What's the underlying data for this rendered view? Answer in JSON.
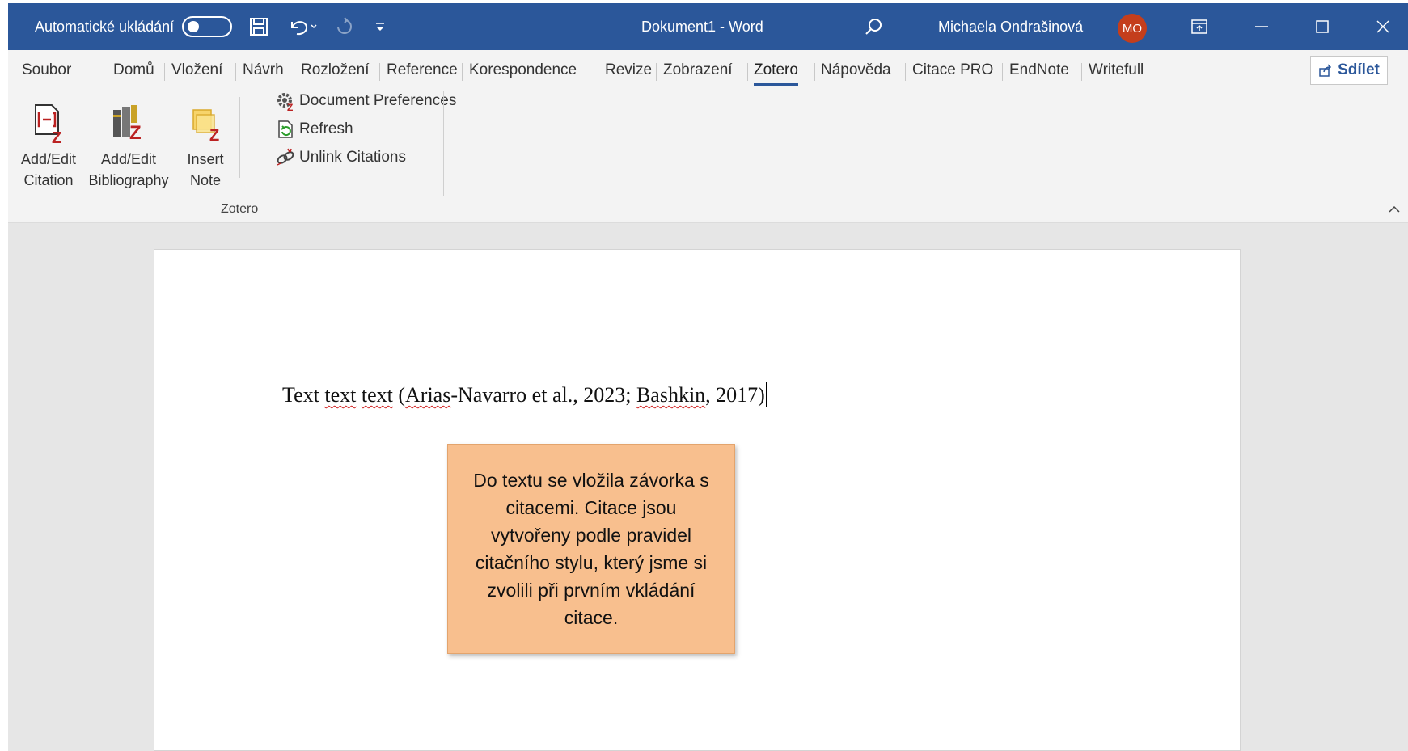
{
  "titlebar": {
    "autosave_label": "Automatické ukládání",
    "document_title": "Dokument1  -  Word",
    "user_name": "Michaela Ondrašinová",
    "user_initials": "MO"
  },
  "tabs": [
    "Soubor",
    "Domů",
    "Vložení",
    "Návrh",
    "Rozložení",
    "Reference",
    "Korespondence",
    "Revize",
    "Zobrazení",
    "Zotero",
    "Nápověda",
    "Citace PRO",
    "EndNote",
    "Writefull"
  ],
  "active_tab": "Zotero",
  "share_label": "Sdílet",
  "ribbon": {
    "add_edit_citation": [
      "Add/Edit",
      "Citation"
    ],
    "add_edit_bibliography": [
      "Add/Edit",
      "Bibliography"
    ],
    "insert_note": [
      "Insert",
      "Note"
    ],
    "document_preferences": "Document Preferences",
    "refresh": "Refresh",
    "unlink_citations": "Unlink Citations",
    "group_label": "Zotero"
  },
  "document": {
    "line_parts": [
      "Text ",
      "text",
      " ",
      "text",
      " (",
      "Arias",
      "-Navarro et al., 2023; ",
      "Bashkin",
      ", 2017)"
    ]
  },
  "callout": {
    "text": "Do textu se vložila závorka s citacemi. Citace jsou vytvořeny podle pravidel citačního stylu, který jsme si zvolili při prvním vkládání citace."
  },
  "colors": {
    "titlebar": "#2b579a",
    "avatar": "#c43e1c",
    "callout": "#f8bf8e"
  }
}
